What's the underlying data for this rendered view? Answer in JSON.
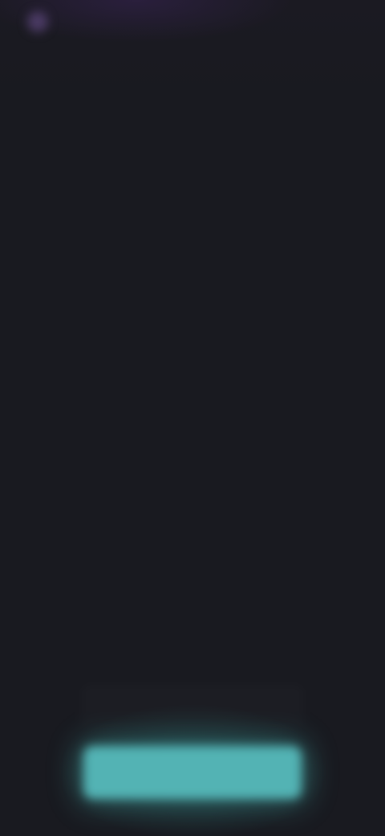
{
  "header": {
    "logo_text": ""
  },
  "main": {
    "title": "",
    "subtitle": ""
  },
  "actions": {
    "secondary_label": "",
    "primary_label": ""
  },
  "colors": {
    "background": "#191a20",
    "accent": "#53b3b4",
    "logo": "#4a3a63"
  },
  "icons": {
    "logo": "app-logo-icon"
  }
}
